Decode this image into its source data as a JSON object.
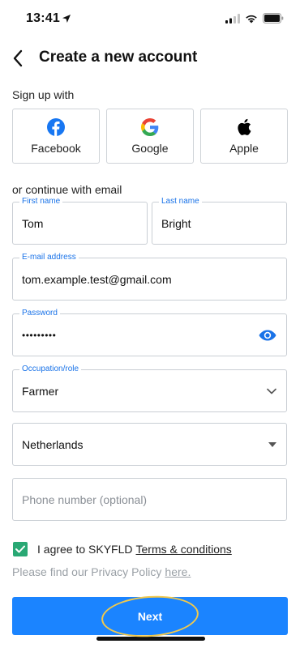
{
  "status_bar": {
    "time": "13:41",
    "icons": [
      "location-arrow-icon",
      "cellular-signal-icon",
      "wifi-icon",
      "battery-icon"
    ]
  },
  "header": {
    "title": "Create a new account",
    "back_icon": "chevron-left-icon"
  },
  "signup": {
    "label": "Sign up with",
    "providers": [
      {
        "label": "Facebook",
        "icon": "facebook-icon",
        "color": "#1877F2"
      },
      {
        "label": "Google",
        "icon": "google-icon",
        "colors": [
          "#4285F4",
          "#EA4335",
          "#FBBC05",
          "#34A853"
        ]
      },
      {
        "label": "Apple",
        "icon": "apple-icon",
        "color": "#000000"
      }
    ]
  },
  "email_section_label": "or continue with email",
  "form": {
    "first_name": {
      "label": "First name",
      "value": "Tom"
    },
    "last_name": {
      "label": "Last name",
      "value": "Bright"
    },
    "email": {
      "label": "E-mail address",
      "value": "tom.example.test@gmail.com"
    },
    "password": {
      "label": "Password",
      "value": "•••••••••",
      "icon": "eye-icon"
    },
    "occupation": {
      "label": "Occupation/role",
      "value": "Farmer",
      "icon": "chevron-down-icon"
    },
    "country": {
      "value": "Netherlands",
      "icon": "caret-down-icon"
    },
    "phone": {
      "placeholder": "Phone number (optional)"
    }
  },
  "agree": {
    "checked": true,
    "text": "I agree to SKYFLD",
    "link": "Terms & conditions"
  },
  "privacy": {
    "text": "Please find our Privacy Policy",
    "link": "here."
  },
  "next_button": {
    "label": "Next"
  },
  "colors": {
    "accent": "#1B84FF",
    "label_blue": "#1A73E8",
    "checkbox_green": "#29A874",
    "highlight_ring": "#F2C94C"
  }
}
